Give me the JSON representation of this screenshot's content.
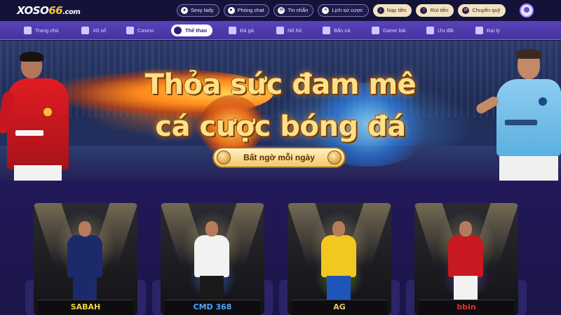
{
  "header": {
    "logo": {
      "brand": "XOSO",
      "number": "66",
      "tld": ".com"
    },
    "actions": [
      {
        "label": "Sexy lady",
        "icon": "circle-dot-icon",
        "style": "outline"
      },
      {
        "label": "Phòng chat",
        "icon": "chat-icon",
        "style": "outline"
      },
      {
        "label": "Tin nhắn",
        "icon": "message-icon",
        "style": "outline"
      },
      {
        "label": "Lịch sử cược",
        "icon": "history-icon",
        "style": "outline"
      },
      {
        "label": "Nạp tiền",
        "icon": "deposit-icon",
        "style": "gold"
      },
      {
        "label": "Rút tiền",
        "icon": "withdraw-icon",
        "style": "gold"
      },
      {
        "label": "Chuyển quỹ",
        "icon": "transfer-icon",
        "style": "gold"
      }
    ]
  },
  "nav": {
    "items": [
      {
        "label": "Trang chủ",
        "icon": "home-icon",
        "active": false
      },
      {
        "label": "Xổ số",
        "icon": "lottery-icon",
        "active": false
      },
      {
        "label": "Casino",
        "icon": "casino-icon",
        "active": false
      },
      {
        "label": "Thể thao",
        "icon": "soccer-ball-icon",
        "active": true
      },
      {
        "label": "Đá gà",
        "icon": "rooster-icon",
        "active": false
      },
      {
        "label": "Nổ hũ",
        "icon": "slot-icon",
        "active": false
      },
      {
        "label": "Bắn cá",
        "icon": "fish-icon",
        "active": false
      },
      {
        "label": "Game bài",
        "icon": "cards-icon",
        "active": false
      },
      {
        "label": "Ưu đãi",
        "icon": "gift-icon",
        "active": false
      },
      {
        "label": "Đại lý",
        "icon": "agent-icon",
        "active": false
      }
    ]
  },
  "hero": {
    "headline_line1": "Thỏa sức đam mê",
    "headline_line2": "cá cược bóng đá",
    "cta_label": "Bất ngờ mỗi ngày"
  },
  "providers": [
    {
      "name": "SABAH",
      "brand_color": "#f4d23a",
      "kit_color": "#1c2a6b"
    },
    {
      "name": "CMD 368",
      "brand_color": "#4aa8ff",
      "kit_color": "#f2f2f2"
    },
    {
      "name": "AG",
      "brand_color": "#e8c46a",
      "kit_color": "#f2c81e"
    },
    {
      "name": "bbin",
      "brand_color": "#e0332c",
      "kit_color": "#c81820"
    }
  ],
  "colors": {
    "accent": "#5844b8",
    "background": "#1c1747",
    "gold": "#f6c53b"
  }
}
